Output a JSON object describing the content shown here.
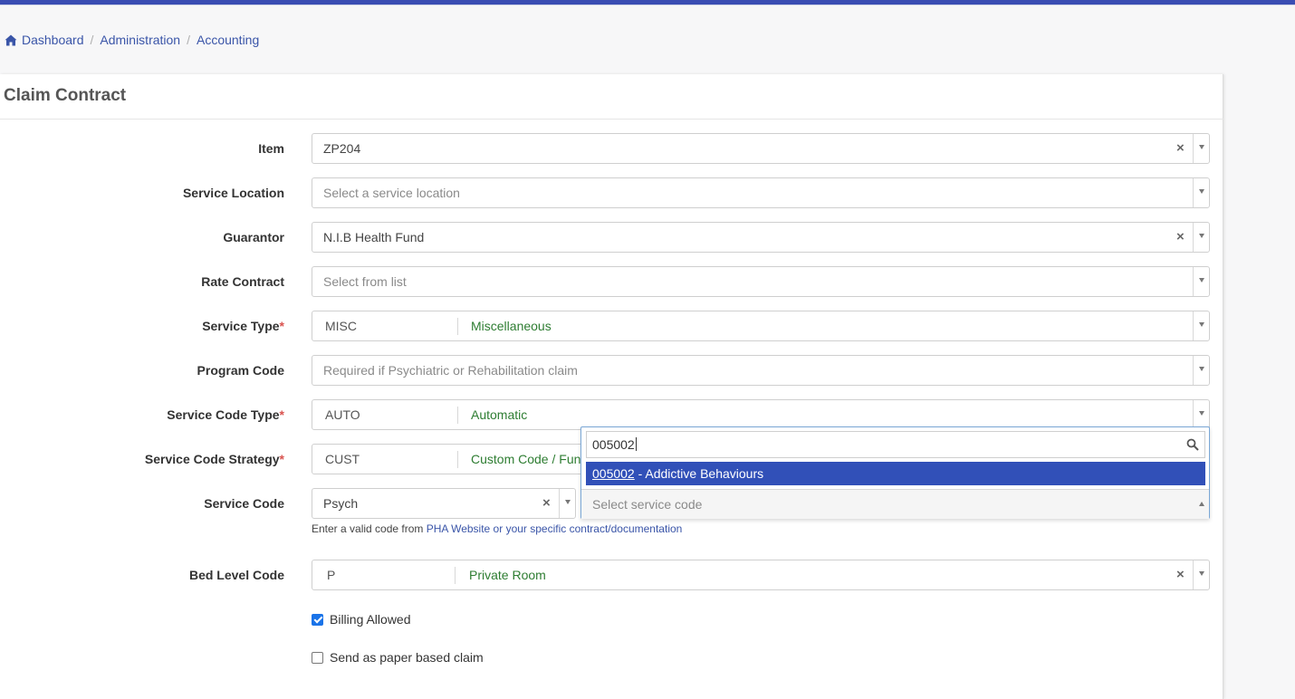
{
  "breadcrumb": {
    "items": [
      "Dashboard",
      "Administration",
      "Accounting"
    ],
    "separator": "/"
  },
  "panel": {
    "title": "Claim Contract"
  },
  "form": {
    "item": {
      "label": "Item",
      "value": "ZP204"
    },
    "service_location": {
      "label": "Service Location",
      "placeholder": "Select a service location"
    },
    "guarantor": {
      "label": "Guarantor",
      "value": "N.I.B Health Fund"
    },
    "rate_contract": {
      "label": "Rate Contract",
      "placeholder": "Select from list"
    },
    "service_type": {
      "label": "Service Type",
      "required": "*",
      "code": "MISC",
      "description": "Miscellaneous"
    },
    "program_code": {
      "label": "Program Code",
      "placeholder": "Required if Psychiatric or Rehabilitation claim"
    },
    "service_code_type": {
      "label": "Service Code Type",
      "required": "*",
      "code": "AUTO",
      "description": "Automatic"
    },
    "service_code_strategy": {
      "label": "Service Code Strategy",
      "required": "*",
      "code": "CUST",
      "description": "Custom Code / Fun"
    },
    "service_code": {
      "label": "Service Code",
      "value": "Psych",
      "select_placeholder": "Select service code",
      "hint_prefix": "Enter a valid code from",
      "hint_link": "PHA Website or your specific contract/documentation"
    },
    "bed_level_code": {
      "label": "Bed Level Code",
      "code": "P",
      "description": "Private Room"
    },
    "billing_allowed": {
      "label": "Billing Allowed",
      "checked": true
    },
    "send_paper": {
      "label": "Send as paper based claim",
      "checked": false
    }
  },
  "dropdown": {
    "search_value": "005002",
    "option": {
      "code": "005002",
      "rest": " - Addictive Behaviours"
    }
  },
  "icons": {
    "home": "home-icon",
    "clear": "×",
    "chevron": "chevron-down-icon",
    "search": "search-icon"
  },
  "colors": {
    "accent": "#3a4db3",
    "link": "#3a55a8",
    "description_green": "#2e7d32",
    "required_red": "#d9534f",
    "highlight": "#3150b8",
    "checkbox": "#1a73e8"
  }
}
